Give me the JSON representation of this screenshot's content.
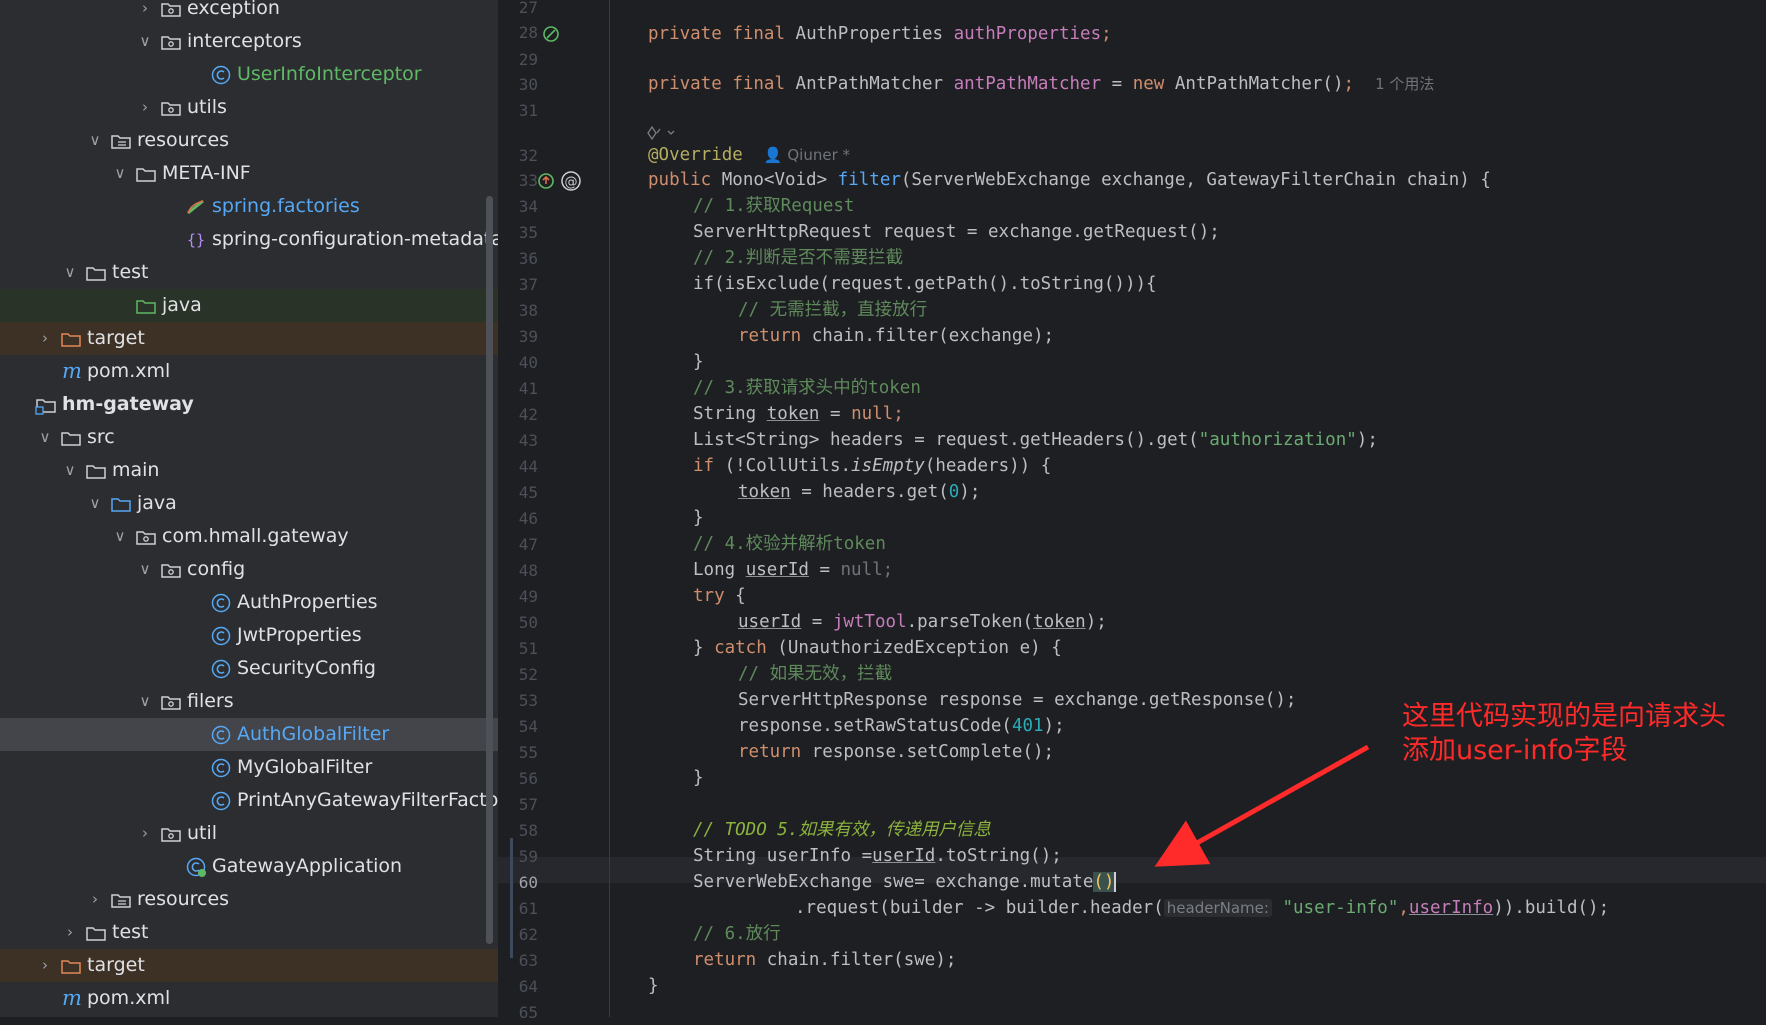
{
  "project_tree": {
    "items": [
      {
        "label": "exception",
        "icon": "package-folder-icon",
        "expanded": false
      },
      {
        "label": "interceptors",
        "icon": "package-folder-icon",
        "expanded": true
      },
      {
        "label": "UserInfoInterceptor",
        "icon": "java-class-icon"
      },
      {
        "label": "utils",
        "icon": "package-folder-icon",
        "expanded": false
      },
      {
        "label": "resources",
        "icon": "resources-folder-icon",
        "expanded": true
      },
      {
        "label": "META-INF",
        "icon": "folder-icon",
        "expanded": true
      },
      {
        "label": "spring.factories",
        "icon": "spring-factories-icon"
      },
      {
        "label": "spring-configuration-metadata.jso",
        "icon": "json-file-icon"
      },
      {
        "label": "test",
        "icon": "folder-icon",
        "expanded": true
      },
      {
        "label": "java",
        "icon": "test-source-folder-icon"
      },
      {
        "label": "target",
        "icon": "excluded-folder-icon",
        "expanded": false
      },
      {
        "label": "pom.xml",
        "icon": "maven-icon"
      },
      {
        "label": "hm-gateway",
        "icon": "module-folder-icon"
      },
      {
        "label": "src",
        "icon": "folder-icon",
        "expanded": true
      },
      {
        "label": "main",
        "icon": "folder-icon",
        "expanded": true
      },
      {
        "label": "java",
        "icon": "source-folder-icon",
        "expanded": true
      },
      {
        "label": "com.hmall.gateway",
        "icon": "package-folder-icon",
        "expanded": true
      },
      {
        "label": "config",
        "icon": "package-folder-icon",
        "expanded": true
      },
      {
        "label": "AuthProperties",
        "icon": "java-class-icon"
      },
      {
        "label": "JwtProperties",
        "icon": "java-class-icon"
      },
      {
        "label": "SecurityConfig",
        "icon": "java-class-icon"
      },
      {
        "label": "filers",
        "icon": "package-folder-icon",
        "expanded": true
      },
      {
        "label": "AuthGlobalFilter",
        "icon": "java-class-icon",
        "selected": true
      },
      {
        "label": "MyGlobalFilter",
        "icon": "java-class-icon"
      },
      {
        "label": "PrintAnyGatewayFilterFactory",
        "icon": "java-class-icon"
      },
      {
        "label": "util",
        "icon": "package-folder-icon",
        "expanded": false
      },
      {
        "label": "GatewayApplication",
        "icon": "spring-boot-class-icon"
      },
      {
        "label": "resources",
        "icon": "resources-folder-icon",
        "expanded": false
      },
      {
        "label": "test",
        "icon": "folder-icon",
        "expanded": false
      },
      {
        "label": "target",
        "icon": "excluded-folder-icon",
        "expanded": false
      },
      {
        "label": "pom.xml",
        "icon": "maven-icon"
      }
    ]
  },
  "editor": {
    "line_numbers": [
      "27",
      "28",
      "29",
      "30",
      "31",
      "32",
      "33",
      "34",
      "35",
      "36",
      "37",
      "38",
      "39",
      "40",
      "41",
      "42",
      "43",
      "44",
      "45",
      "46",
      "47",
      "48",
      "49",
      "50",
      "51",
      "52",
      "53",
      "54",
      "55",
      "56",
      "57",
      "58",
      "59",
      "60",
      "61",
      "62",
      "63",
      "64",
      "65"
    ],
    "current_line": "60",
    "gutter_icons": {
      "line28": "bean-navigation-icon",
      "line33": "override-method-icon",
      "line33b": "annotation-at-icon"
    },
    "code": {
      "private": "private",
      "final": "final",
      "AuthProperties": "AuthProperties",
      "authProperties": "authProperties",
      "AntPathMatcher": "AntPathMatcher",
      "antPathMatcher": "antPathMatcher",
      "new": "new",
      "usages_hint": "1 个用法",
      "override": "@Override",
      "author_hint": "Qiuner *",
      "public": "public",
      "mono_void": "Mono<Void>",
      "filter": "filter",
      "filter_params": "(ServerWebExchange exchange, GatewayFilterChain chain) {",
      "c1": "// 1.获取Request",
      "l35": "ServerHttpRequest request = exchange.getRequest();",
      "c2": "// 2.判断是否不需要拦截",
      "l37": "if(isExclude(request.getPath().toString())){",
      "c_noblock": "// 无需拦截，直接放行",
      "return": "return",
      "l39": " chain.filter(exchange);",
      "close_brace": "}",
      "c3": "// 3.获取请求头中的token",
      "string_token": "String ",
      "token": "token",
      "eq": " = ",
      "null": "null",
      "semi": ";",
      "l43a": "List<String> headers = request.getHeaders().get(",
      "authorization": "\"authorization\"",
      "l43b": ");",
      "if_not": "if (!CollUtils.",
      "isEmpty": "isEmpty",
      "l44b": "(headers)) {",
      "l45b": " = headers.get(",
      "zero": "0",
      "l45c": ");",
      "c4": "// 4.校验并解析token",
      "long_userid": "Long ",
      "userId": "userId",
      "try": "try",
      "open_brace": " {",
      "jwtTool": "jwtTool",
      "parseToken": ".parseToken(",
      "close_paren_semi": ");",
      "catch_open": "} ",
      "catch": "catch",
      "catch_rest": " (UnauthorizedException e) {",
      "c_invalid": "// 如果无效，拦截",
      "l53": "ServerHttpResponse response = exchange.getResponse();",
      "l54a": "response.setRawStatusCode(",
      "n401": "401",
      "l54b": ");",
      "l55": " response.setComplete();",
      "c5_prefix": "// ",
      "todo": "TODO",
      "c5_rest": " 5.如果有效，传递用户信息",
      "l59a": "String userInfo =",
      "l59b": ".toString();",
      "l60a": "ServerWebExchange swe= exchange.mutate",
      "parens": "()",
      "l61a": ".request(builder -> builder.header(",
      "headerName": "headerName:",
      "user_info_str": "\"user-info\"",
      "comma": ",",
      "userInfo": "userInfo",
      "l61b": ")).build();",
      "c6": "// 6.放行",
      "l63": " chain.filter(swe);"
    }
  },
  "annotation": {
    "text_line1": "这里代码实现的是向请求头",
    "text_line2": "添加user-info字段",
    "color": "#ff2a2a"
  }
}
